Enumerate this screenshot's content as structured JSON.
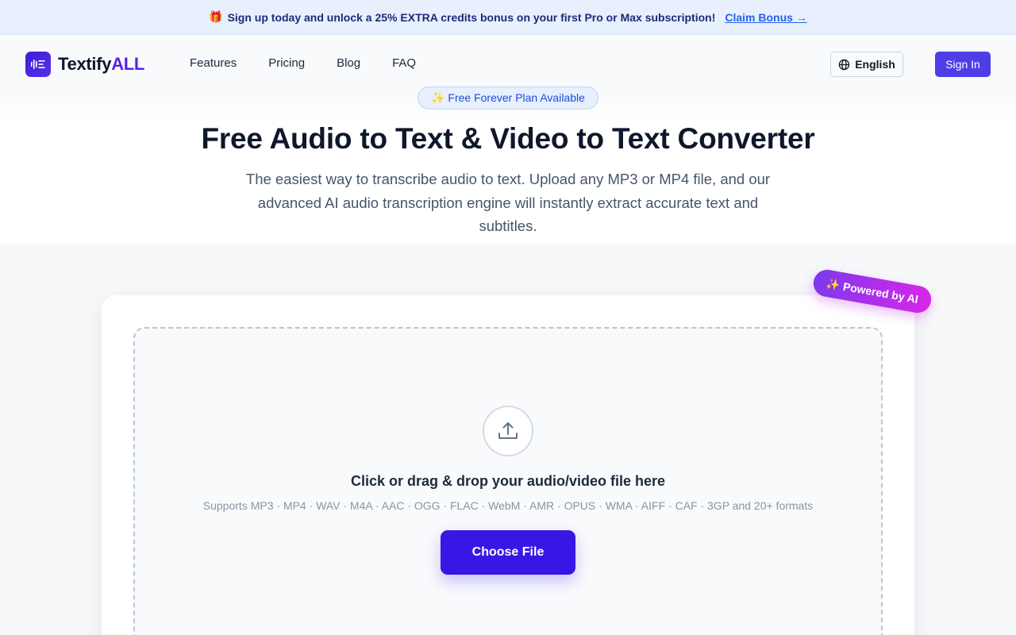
{
  "promo": {
    "icon": "gift-icon",
    "text": "Sign up today and unlock a 25% EXTRA credits bonus on your first Pro or Max subscription!",
    "cta": "Claim Bonus →"
  },
  "header": {
    "logo_main": "Textify",
    "logo_accent": "ALL",
    "nav": [
      "Features",
      "Pricing",
      "Blog",
      "FAQ"
    ],
    "language": "English",
    "signin": "Sign In"
  },
  "hero": {
    "badge": "✨ Free Forever Plan Available",
    "title": "Free Audio to Text & Video to Text Converter",
    "subtitle": "The easiest way to transcribe audio to text. Upload any MP3 or MP4 file, and our advanced AI audio transcription engine will instantly extract accurate text and subtitles."
  },
  "uploader": {
    "ai_tag": "✨ Powered by AI",
    "title": "Click or drag & drop your audio/video file here",
    "formats": "Supports MP3 · MP4 · WAV · M4A · AAC · OGG · FLAC · WebM · AMR · OPUS · WMA · AIFF · CAF · 3GP and 20+ formats",
    "button": "Choose File"
  },
  "colors": {
    "brand": "#3a16e6",
    "accent_purple": "#5b21e6",
    "promo_bg": "#e8effd"
  }
}
